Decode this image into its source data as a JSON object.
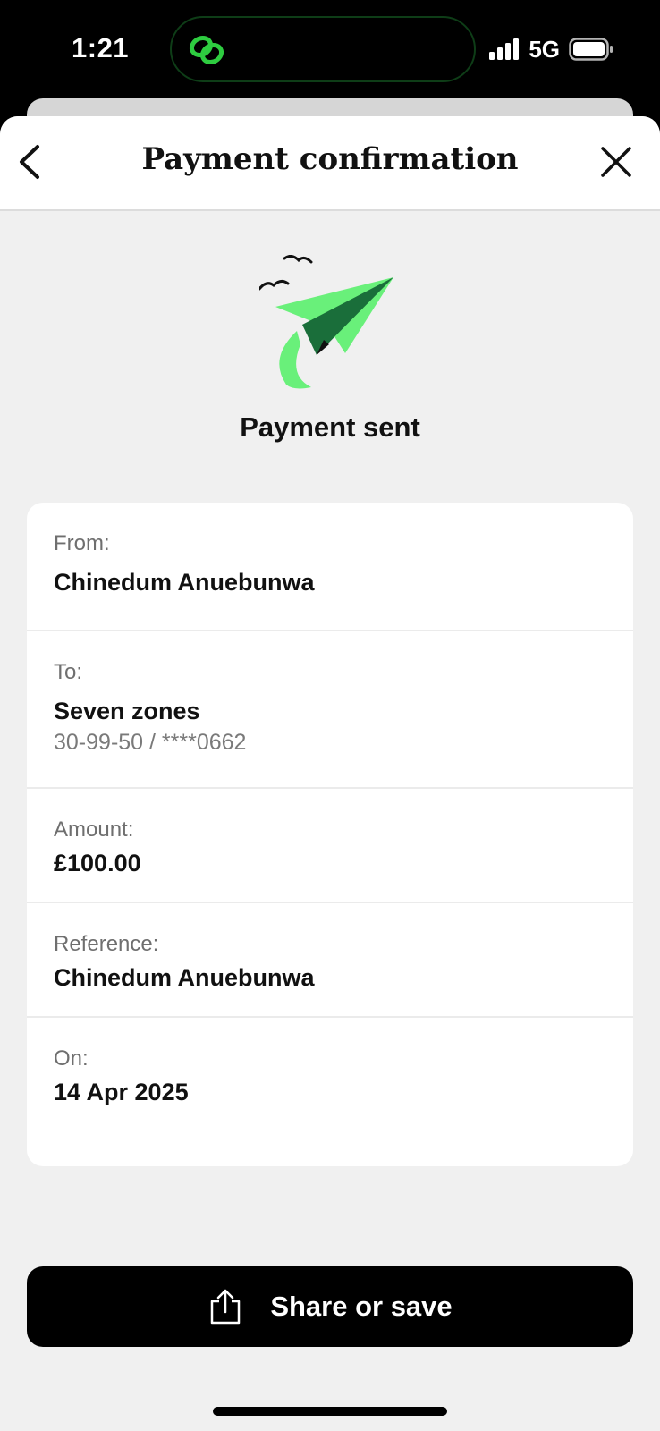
{
  "status_bar": {
    "time": "1:21",
    "network": "5G",
    "accent": "#2ecc40"
  },
  "header": {
    "title": "Payment confirmation",
    "back_icon": "chevron-left-icon",
    "close_icon": "close-icon"
  },
  "hero": {
    "icon": "paper-plane-icon",
    "title": "Payment sent",
    "accent_light": "#69f07a",
    "accent_dark": "#1a6e3a"
  },
  "details": {
    "from_label": "From:",
    "from_value": "Chinedum Anuebunwa",
    "to_label": "To:",
    "to_value": "Seven zones",
    "to_account": "30-99-50 / ****0662",
    "amount_label": "Amount:",
    "amount_value": "£100.00",
    "reference_label": "Reference:",
    "reference_value": "Chinedum Anuebunwa",
    "on_label": "On:",
    "on_value": "14 Apr 2025"
  },
  "actions": {
    "share_label": "Share or save",
    "share_icon": "share-icon"
  }
}
